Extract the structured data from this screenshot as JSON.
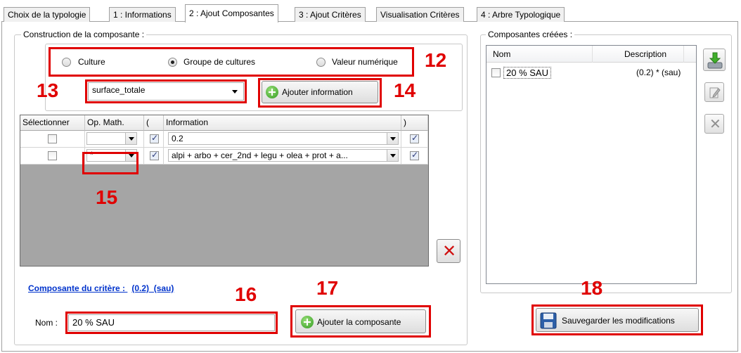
{
  "tabs": [
    {
      "label": "Choix de la typologie"
    },
    {
      "label": "1 : Informations"
    },
    {
      "label": "2 : Ajout Composantes"
    },
    {
      "label": "3 : Ajout Critères"
    },
    {
      "label": "Visualisation Critères"
    },
    {
      "label": "4 : Arbre Typologique"
    }
  ],
  "construction": {
    "title": "Construction de la composante :",
    "radios": [
      {
        "label": "Culture",
        "selected": false
      },
      {
        "label": "Groupe de cultures",
        "selected": true
      },
      {
        "label": "Valeur numérique",
        "selected": false
      }
    ],
    "info_select": {
      "value": "surface_totale"
    },
    "add_info_label": "Ajouter information"
  },
  "grid": {
    "headers": [
      "Sélectionner",
      "Op. Math.",
      "(",
      "Information",
      ")"
    ],
    "rows": [
      {
        "select": false,
        "op": "",
        "open": true,
        "information": "0.2",
        "close": true
      },
      {
        "select": false,
        "op": "*",
        "open": true,
        "information": "alpi + arbo + cer_2nd + legu + olea + prot + a...",
        "close": true
      }
    ]
  },
  "composante": {
    "link_label": "Composante du critère :",
    "link_value": "(0.2)  (sau)",
    "name_label": "Nom :",
    "name_value": "20 % SAU",
    "add_label": "Ajouter la composante"
  },
  "created": {
    "title": "Composantes créées :",
    "columns": [
      "Nom",
      "Description"
    ],
    "rows": [
      {
        "name": "20 % SAU",
        "description": "(0.2) * (sau)",
        "checked": false
      }
    ],
    "save_label": "Sauvegarder les modifications"
  },
  "annotations": [
    "12",
    "13",
    "14",
    "15",
    "16",
    "17",
    "18"
  ],
  "colors": {
    "annotation": "#e00000",
    "link": "#0033cc",
    "grid_bg": "#a5a5a5"
  }
}
